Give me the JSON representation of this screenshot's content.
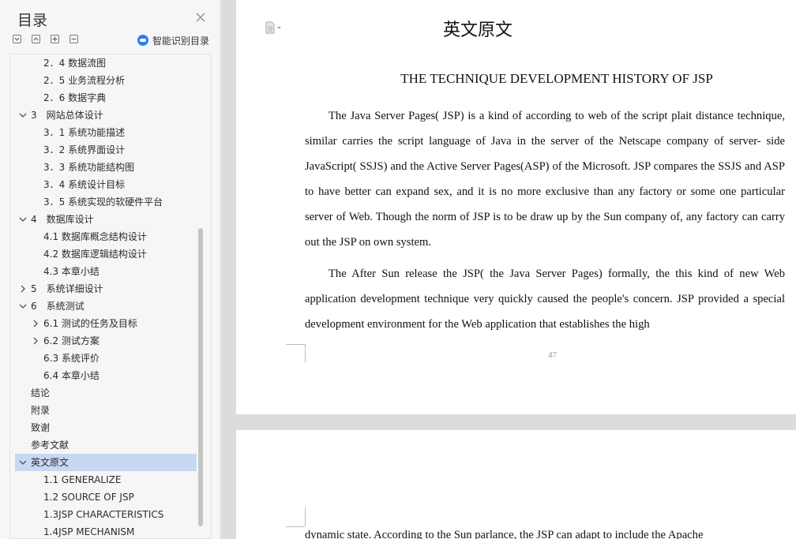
{
  "sidebar": {
    "title": "目录",
    "smart_toc_label": "智能识别目录",
    "items": [
      {
        "label": "2．4 数据流图",
        "level": 2,
        "expand": "none",
        "selected": false
      },
      {
        "label": "2．5 业务流程分析",
        "level": 2,
        "expand": "none",
        "selected": false
      },
      {
        "label": "2．6 数据字典",
        "level": 2,
        "expand": "none",
        "selected": false
      },
      {
        "label": "3　网站总体设计",
        "level": 1,
        "expand": "open",
        "selected": false
      },
      {
        "label": "3．1 系统功能描述",
        "level": 2,
        "expand": "none",
        "selected": false
      },
      {
        "label": "3．2 系统界面设计",
        "level": 2,
        "expand": "none",
        "selected": false
      },
      {
        "label": "3．3 系统功能结构图",
        "level": 2,
        "expand": "none",
        "selected": false
      },
      {
        "label": "3．4 系统设计目标",
        "level": 2,
        "expand": "none",
        "selected": false
      },
      {
        "label": "3．5 系统实现的软硬件平台",
        "level": 2,
        "expand": "none",
        "selected": false
      },
      {
        "label": "4　数据库设计",
        "level": 1,
        "expand": "open",
        "selected": false
      },
      {
        "label": "4.1 数据库概念结构设计",
        "level": 2,
        "expand": "none",
        "selected": false
      },
      {
        "label": "4.2 数据库逻辑结构设计",
        "level": 2,
        "expand": "none",
        "selected": false
      },
      {
        "label": "4.3 本章小结",
        "level": 2,
        "expand": "none",
        "selected": false
      },
      {
        "label": "5　系统详细设计",
        "level": 1,
        "expand": "closed",
        "selected": false
      },
      {
        "label": "6　系统测试",
        "level": 1,
        "expand": "open",
        "selected": false
      },
      {
        "label": "6.1 测试的任务及目标",
        "level": 2,
        "expand": "closed",
        "selected": false
      },
      {
        "label": "6.2 测试方案",
        "level": 2,
        "expand": "closed",
        "selected": false
      },
      {
        "label": "6.3 系统评价",
        "level": 2,
        "expand": "none",
        "selected": false
      },
      {
        "label": "6.4 本章小结",
        "level": 2,
        "expand": "none",
        "selected": false
      },
      {
        "label": "结论",
        "level": 1,
        "expand": "none",
        "selected": false
      },
      {
        "label": "附录",
        "level": 1,
        "expand": "none",
        "selected": false
      },
      {
        "label": "致谢",
        "level": 1,
        "expand": "none",
        "selected": false
      },
      {
        "label": "参考文献",
        "level": 1,
        "expand": "none",
        "selected": false
      },
      {
        "label": "英文原文",
        "level": 1,
        "expand": "open",
        "selected": true
      },
      {
        "label": "1.1 GENERALIZE",
        "level": 2,
        "expand": "none",
        "selected": false
      },
      {
        "label": "1.2 SOURCE OF JSP",
        "level": 2,
        "expand": "none",
        "selected": false
      },
      {
        "label": "1.3JSP CHARACTERISTICS",
        "level": 2,
        "expand": "none",
        "selected": false
      },
      {
        "label": "1.4JSP MECHANISM",
        "level": 2,
        "expand": "none",
        "selected": false
      }
    ]
  },
  "document": {
    "header_title": "英文原文",
    "heading": "THE TECHNIQUE DEVELOPMENT HISTORY OF JSP",
    "para1": "The Java Server Pages( JSP) is a kind of according to web of the script plait distance technique, similar carries the script language of Java in the server of the Netscape company of server- side JavaScript( SSJS) and the Active Server Pages(ASP) of the Microsoft. JSP compares the SSJS and ASP to have better can expand sex, and it is no more exclusive than any factory or some one particular server of Web. Though the norm of JSP is to be draw up by the Sun company of, any factory can carry out the JSP on own system.",
    "para2": "The After Sun release the JSP( the Java Server Pages) formally, the this kind of new Web application development technique very quickly caused the people's concern. JSP provided a special development environment for the Web application that establishes the high",
    "page_number": "47",
    "page2_partial": "dynamic state. According to the Sun parlance, the JSP can adapt to include the Apache"
  }
}
